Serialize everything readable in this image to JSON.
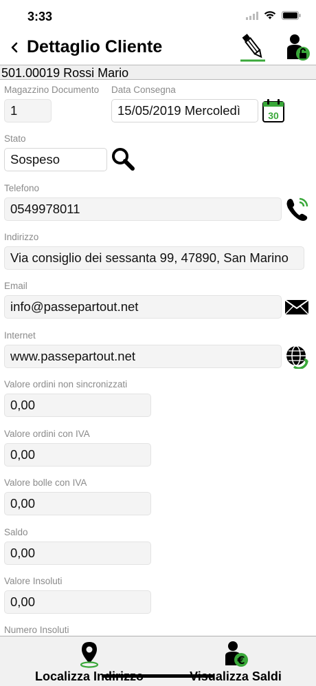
{
  "status": {
    "time": "3:33"
  },
  "nav": {
    "title": "Dettaglio Cliente"
  },
  "customer": {
    "header": "501.00019 Rossi Mario"
  },
  "fields": {
    "warehouse": {
      "label": "Magazzino Documento",
      "value": "1"
    },
    "delivery": {
      "label": "Data Consegna",
      "value": "15/05/2019  Mercoledì",
      "calendar_day": "30"
    },
    "state": {
      "label": "Stato",
      "value": "Sospeso"
    },
    "phone": {
      "label": "Telefono",
      "value": "0549978011"
    },
    "address": {
      "label": "Indirizzo",
      "value": "Via consiglio dei sessanta 99, 47890, San Marino"
    },
    "email": {
      "label": "Email",
      "value": "info@passepartout.net"
    },
    "internet": {
      "label": "Internet",
      "value": "www.passepartout.net"
    },
    "unsynced_orders": {
      "label": "Valore ordini non sincronizzati",
      "value": "0,00"
    },
    "orders_vat": {
      "label": "Valore ordini con IVA",
      "value": "0,00"
    },
    "delivery_notes_vat": {
      "label": "Valore bolle con IVA",
      "value": "0,00"
    },
    "balance": {
      "label": "Saldo",
      "value": "0,00"
    },
    "unpaid_value": {
      "label": "Valore Insoluti",
      "value": "0,00"
    },
    "unpaid_count": {
      "label": "Numero Insoluti"
    }
  },
  "tabs": {
    "locate": {
      "label": "Localizza Indirizzo",
      "icon": "map-pin-icon"
    },
    "balances": {
      "label": "Visualizza Saldi",
      "icon": "user-euro-icon"
    }
  },
  "colors": {
    "accent_green": "#3aa83a",
    "field_bg": "#f4f4f4",
    "tab_bg": "#f1f1f1"
  }
}
